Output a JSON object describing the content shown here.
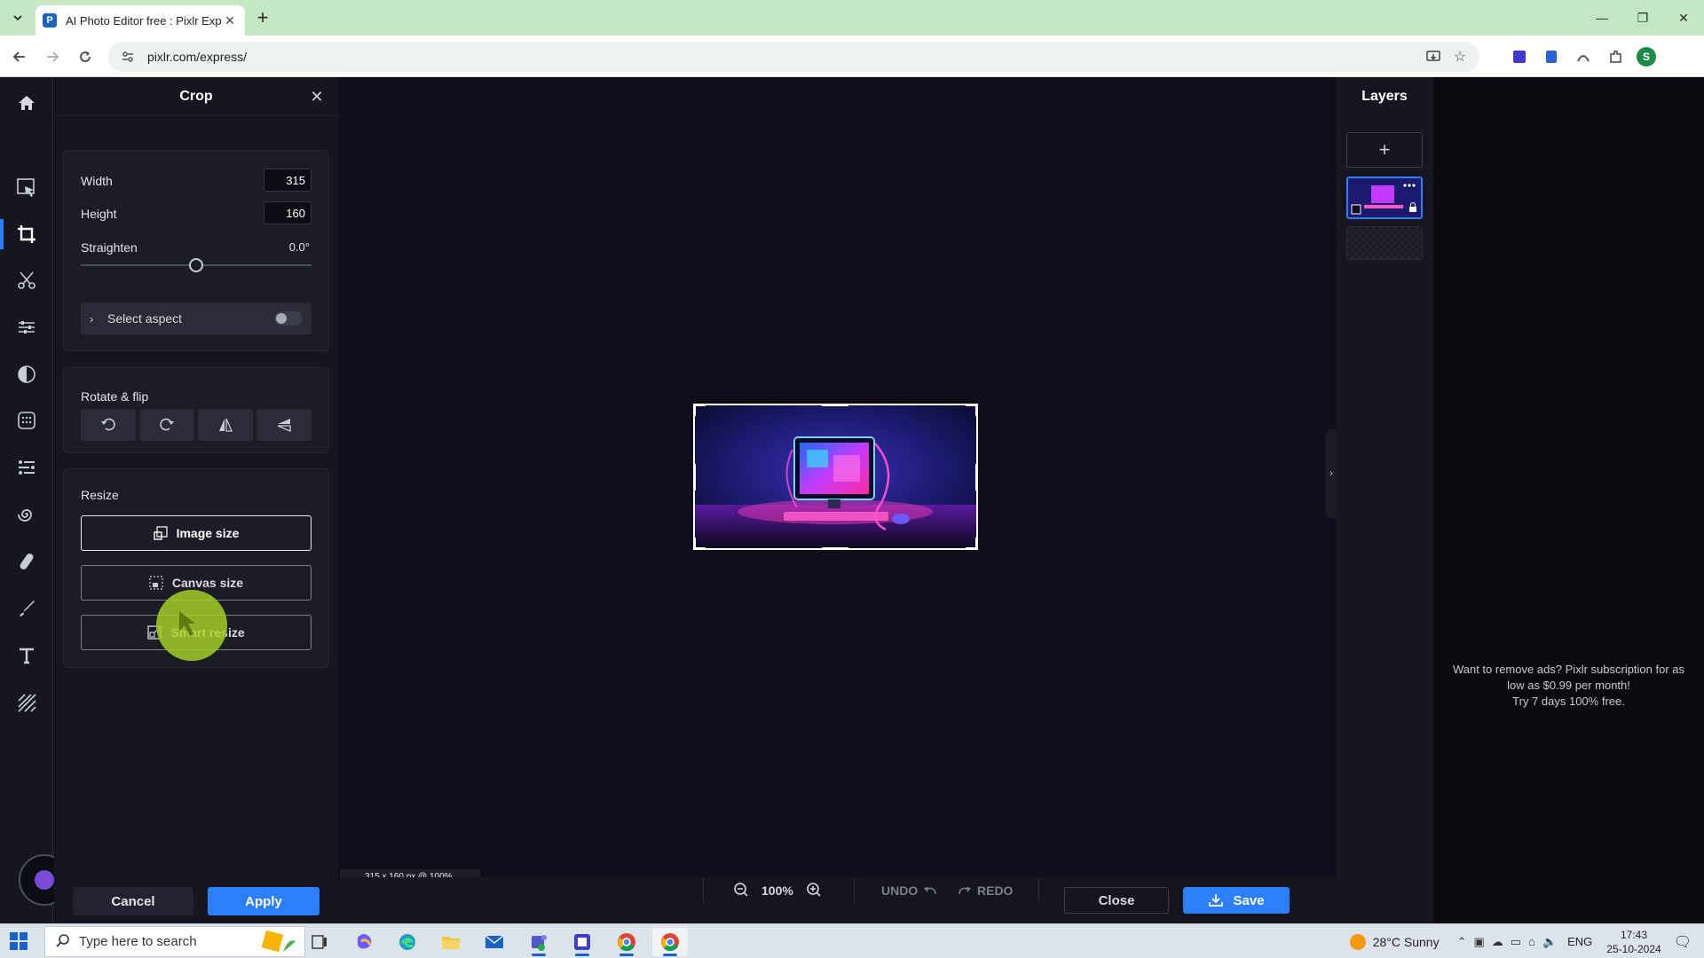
{
  "browser": {
    "tab_title": "AI Photo Editor free : Pixlr Express",
    "url": "pixlr.com/express/",
    "profile_initial": "S"
  },
  "crop_panel": {
    "title": "Crop",
    "width_label": "Width",
    "width_value": "315",
    "height_label": "Height",
    "height_value": "160",
    "straighten_label": "Straighten",
    "straighten_value": "0.0°",
    "straighten_level": 0.5,
    "select_aspect_label": "Select aspect",
    "rotate_flip_label": "Rotate & flip",
    "resize_label": "Resize",
    "image_size_label": "Image size",
    "canvas_size_label": "Canvas size",
    "smart_resize_label": "Smart resize",
    "cancel_label": "Cancel",
    "apply_label": "Apply"
  },
  "canvas": {
    "image_info": "315 x 160 px @ 100%"
  },
  "bottom_bar": {
    "zoom": "100%",
    "undo_label": "UNDO",
    "redo_label": "REDO",
    "close_label": "Close",
    "save_label": "Save"
  },
  "layers": {
    "title": "Layers"
  },
  "ad": {
    "line1": "Want to remove ads? Pixlr subscription for as",
    "line2": "low as $0.99 per month!",
    "line3": "Try 7 days 100% free."
  },
  "taskbar": {
    "search_placeholder": "Type here to search",
    "weather": "28°C  Sunny",
    "language": "ENG",
    "time": "17:43",
    "date": "25-10-2024"
  },
  "colors": {
    "accent": "#2d7ff9",
    "panel": "#15161f",
    "canvas": "#0e0f1a",
    "browser_frame": "#c6e7c4"
  }
}
